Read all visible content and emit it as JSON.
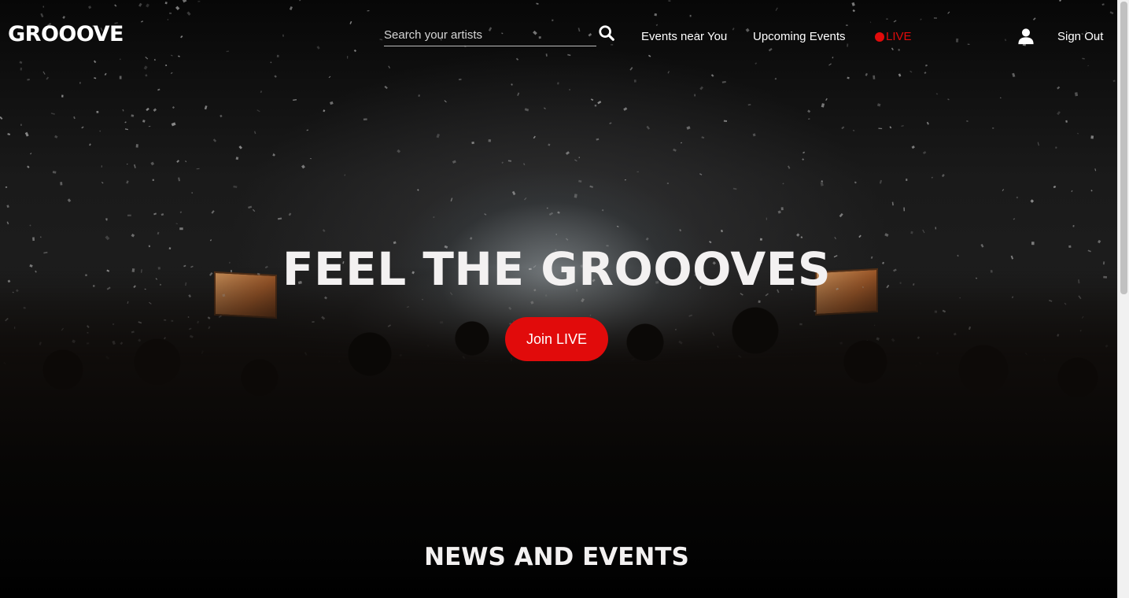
{
  "header": {
    "logo": "GROOOVE",
    "search": {
      "placeholder": "Search your artists",
      "value": ""
    },
    "nav": {
      "events_near": "Events near You",
      "upcoming": "Upcoming Events",
      "live": "LIVE",
      "sign_out": "Sign Out"
    }
  },
  "hero": {
    "title": "FEEL THE GROOOVES",
    "button": "Join LIVE"
  },
  "sections": {
    "news_heading": "NEWS AND EVENTS"
  },
  "colors": {
    "accent": "#e10b0b",
    "background": "#000000",
    "text": "#ffffff"
  },
  "icons": {
    "search": "search-icon",
    "user": "user-icon",
    "live": "live-dot-icon"
  }
}
